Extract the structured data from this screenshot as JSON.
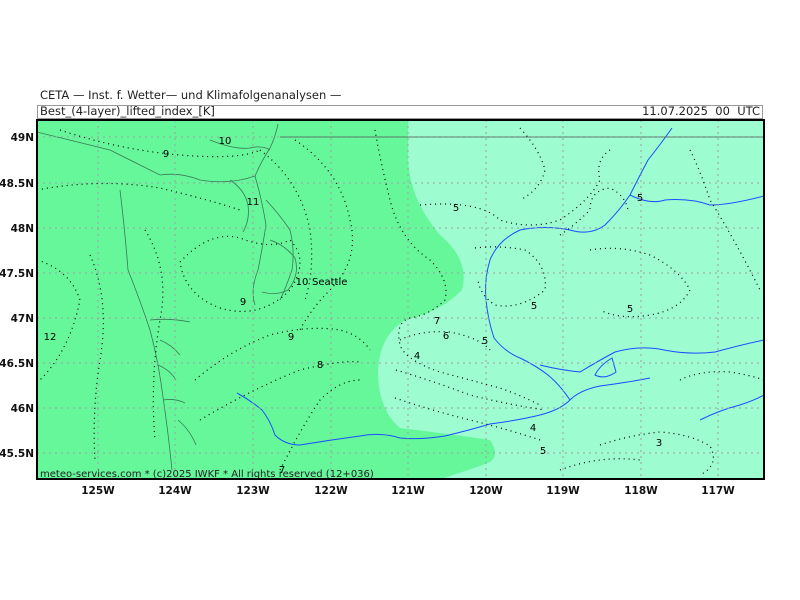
{
  "header": {
    "institute": "CETA — Inst. f. Wetter— und Klimafolgenanalysen —",
    "title": "Best_(4-layer)_lifted_index_[K]",
    "datetime": "11.07.2025  00  UTC"
  },
  "footer": {
    "credit": "meteo-services.com * (c)2025 IWKF * All rights reserved (12+036)"
  },
  "axes": {
    "x_ticks": [
      "125W",
      "124W",
      "123W",
      "122W",
      "121W",
      "120W",
      "119W",
      "118W",
      "117W"
    ],
    "y_ticks": [
      "49N",
      "48.5N",
      "48N",
      "47.5N",
      "47N",
      "46.5N",
      "46N",
      "45.5N"
    ]
  },
  "places": {
    "seattle": "Seattle"
  },
  "contour_labels": [
    {
      "name": "label-10-north",
      "text": "10"
    },
    {
      "name": "label-9-north",
      "text": "9"
    },
    {
      "name": "label-11",
      "text": "11"
    },
    {
      "name": "label-10-seattle",
      "text": "10"
    },
    {
      "name": "label-9-puget",
      "text": "9"
    },
    {
      "name": "label-9-south",
      "text": "9"
    },
    {
      "name": "label-8",
      "text": "8"
    },
    {
      "name": "label-12",
      "text": "12"
    },
    {
      "name": "label-7",
      "text": "7"
    },
    {
      "name": "label-6",
      "text": "6"
    },
    {
      "name": "label-5-central",
      "text": "5"
    },
    {
      "name": "label-4-west",
      "text": "4"
    },
    {
      "name": "label-5-north",
      "text": "5"
    },
    {
      "name": "label-5-east-a",
      "text": "5"
    },
    {
      "name": "label-5-east-b",
      "text": "5"
    },
    {
      "name": "label-5-ne",
      "text": "5"
    },
    {
      "name": "label-4-south",
      "text": "4"
    },
    {
      "name": "label-5-south",
      "text": "5"
    },
    {
      "name": "label-3",
      "text": "3"
    },
    {
      "name": "label-7-bottom",
      "text": "7"
    }
  ],
  "colors": {
    "stable_fill": "#66f79a",
    "less_stable_fill": "#9dfcd0",
    "water": "#1a4dff",
    "contour": "#000000",
    "grid": "#a0a0a0",
    "coast": "#3a7a55"
  }
}
